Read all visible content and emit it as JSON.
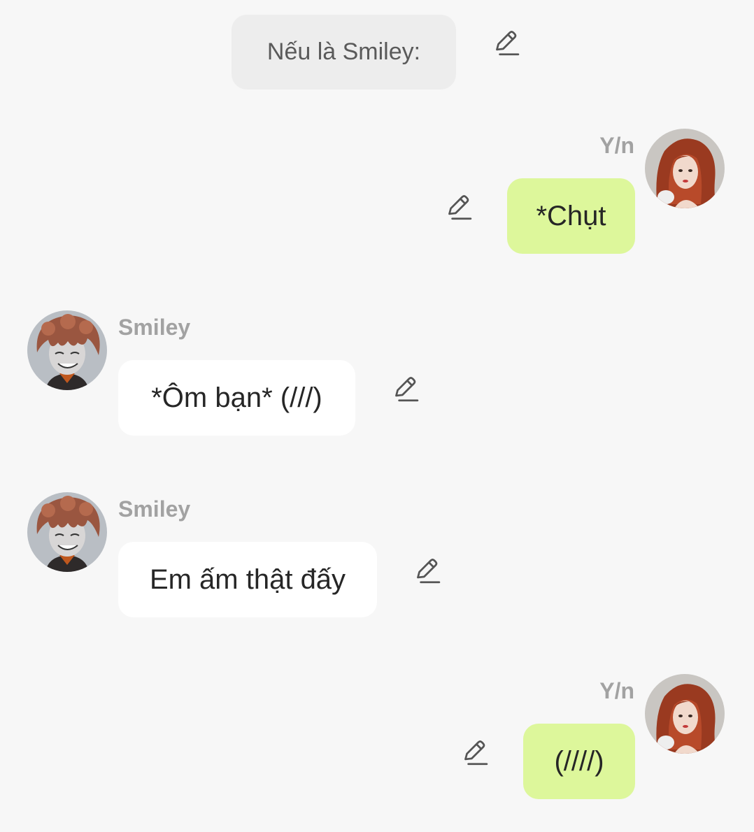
{
  "narration": {
    "text": "Nếu là Smiley:"
  },
  "messages": [
    {
      "sender": "Y/n",
      "text": "*Chụt"
    },
    {
      "sender": "Smiley",
      "text": "*Ôm bạn* (///)"
    },
    {
      "sender": "Smiley",
      "text": "Em ấm thật đấy"
    },
    {
      "sender": "Y/n",
      "text": "(////)"
    }
  ],
  "icons": {
    "edit": "pencil-edit-icon",
    "avatar_yn": "avatar-yn",
    "avatar_smiley": "avatar-smiley"
  },
  "colors": {
    "background": "#f7f7f7",
    "narration_bubble": "#ededed",
    "outgoing_bubble": "#ddf79b",
    "incoming_bubble": "#ffffff",
    "sender_name": "#a2a2a2",
    "message_text": "#262626"
  }
}
